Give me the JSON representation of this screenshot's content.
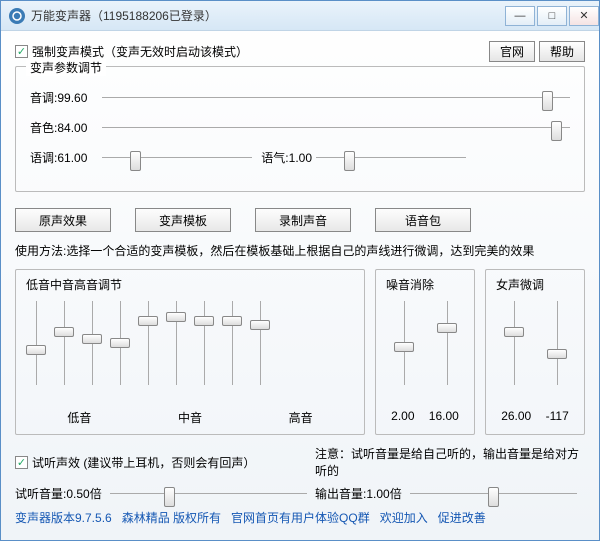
{
  "title": "万能变声器（1195188206已登录）",
  "checkbox_force": "强制变声模式（变声无效时启动该模式）",
  "btn_site": "官网",
  "btn_help": "帮助",
  "group_params_title": "变声参数调节",
  "pitch_label": "音调:",
  "pitch_value": "99.60",
  "pitch_pct": 95,
  "timbre_label": "音色:",
  "timbre_value": "84.00",
  "timbre_pct": 97,
  "tone_label": "语调:",
  "tone_value": "61.00",
  "tone_pct": 22,
  "mood_label": "语气:",
  "mood_value": "1.00",
  "mood_pct": 22,
  "btn_original": "原声效果",
  "btn_template": "变声模板",
  "btn_record": "录制声音",
  "btn_voicepack": "语音包",
  "usage_hint": "使用方法:选择一个合适的变声模板，然后在模板基础上根据自己的声线进行微调，达到完美的效果",
  "eq_title": "低音中音高音调节",
  "eq_band_labels": {
    "low": "低音",
    "mid": "中音",
    "high": "高音"
  },
  "eq_positions": [
    60,
    35,
    45,
    50,
    20,
    15,
    20,
    20,
    25
  ],
  "noise_title": "噪音消除",
  "noise_positions": [
    55,
    30
  ],
  "noise_vals": {
    "a": "2.00",
    "b": "16.00"
  },
  "female_title": "女声微调",
  "female_positions": [
    35,
    65
  ],
  "female_vals": {
    "a": "26.00",
    "b": "-117"
  },
  "preview_chk": "试听声效 (建议带上耳机，否则会有回声）",
  "preview_note": "注意：试听音量是给自己听的，输出音量是给对方听的",
  "preview_vol_label": "试听音量:",
  "preview_vol_value": "0.50倍",
  "preview_vol_pct": 30,
  "output_vol_label": "输出音量:",
  "output_vol_value": "1.00倍",
  "output_vol_pct": 50,
  "footer": {
    "version": "变声器版本9.7.5.6",
    "copyright": "森林精品 版权所有",
    "qq": "官网首页有用户体验QQ群",
    "welcome": "欢迎加入",
    "improve": "促进改善"
  }
}
